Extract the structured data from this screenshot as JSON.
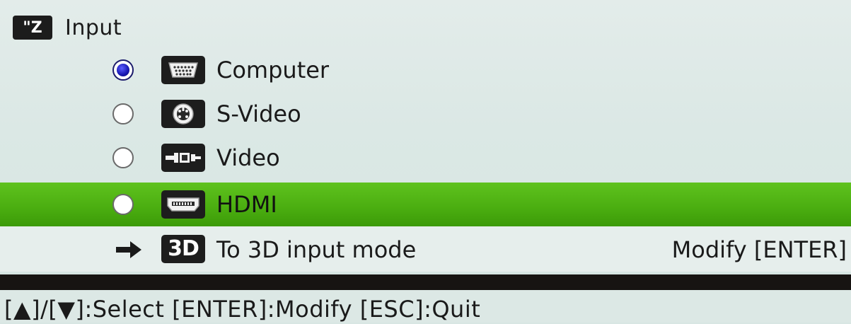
{
  "header": {
    "logo_icon": "input-source-icon",
    "logo_text": "\"Z",
    "title": "Input"
  },
  "sources": [
    {
      "label": "Computer",
      "icon": "vga-port-icon",
      "selected": true,
      "highlighted": false
    },
    {
      "label": "S-Video",
      "icon": "s-video-port-icon",
      "selected": false,
      "highlighted": false
    },
    {
      "label": "Video",
      "icon": "composite-video-port-icon",
      "selected": false,
      "highlighted": false
    },
    {
      "label": "HDMI",
      "icon": "hdmi-port-icon",
      "selected": false,
      "highlighted": true
    }
  ],
  "mode_3d": {
    "icon": "arrow-right-icon",
    "badge": "3D",
    "label": "To 3D input mode",
    "action": "Modify [ENTER]"
  },
  "footer": {
    "hint": "[▲]/[▼]:Select [ENTER]:Modify [ESC]:Quit"
  },
  "colors": {
    "highlight": "#4aad10",
    "background": "#dbe8e5",
    "radio_selected": "#1616b0",
    "separator": "#171412"
  }
}
